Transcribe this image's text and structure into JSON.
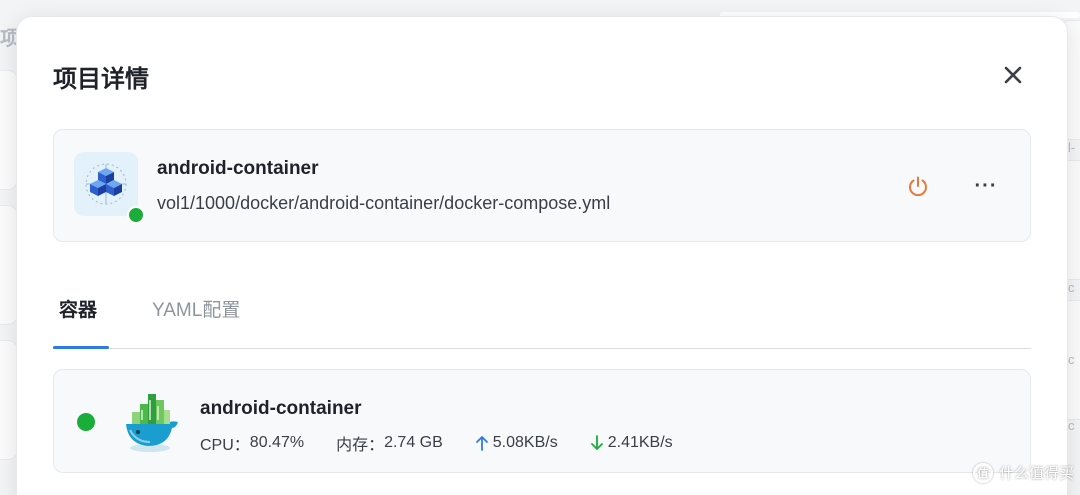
{
  "background": {
    "left_char": "项",
    "right_chars": [
      "l-",
      "c",
      "c",
      "c"
    ]
  },
  "modal": {
    "title": "项目详情",
    "close_icon": "close-icon"
  },
  "project": {
    "name": "android-container",
    "path": "vol1/1000/docker/android-container/docker-compose.yml",
    "status": "running",
    "status_color": "#1aad3a",
    "power_icon": "power-icon",
    "power_color": "#e8793a",
    "more_label": "···"
  },
  "tabs": [
    {
      "label": "容器",
      "active": true
    },
    {
      "label": "YAML配置",
      "active": false
    }
  ],
  "accent_color": "#2f7be4",
  "containers": [
    {
      "name": "android-container",
      "status": "running",
      "cpu_label": "CPU：",
      "cpu_value": "80.47%",
      "mem_label": "内存：",
      "mem_value": "2.74 GB",
      "upload_value": "5.08KB/s",
      "download_value": "2.41KB/s",
      "upload_color": "#2f7be4",
      "download_color": "#1aad3a"
    }
  ],
  "watermark": {
    "icon_text": "值",
    "text": "什么值得买"
  }
}
